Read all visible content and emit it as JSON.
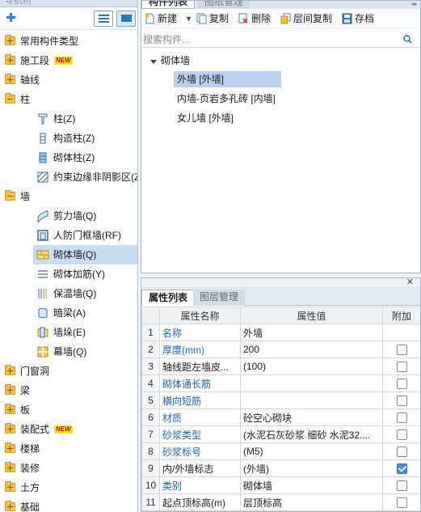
{
  "left_nav": {
    "header_label": "导航树",
    "tree": [
      {
        "label": "常用构件类型",
        "expanded": false
      },
      {
        "label": "施工段",
        "expanded": false,
        "badge": "NEW"
      },
      {
        "label": "轴线",
        "expanded": false
      },
      {
        "label": "柱",
        "expanded": true,
        "children": [
          "柱(Z)",
          "构造柱(Z)",
          "砌体柱(Z)",
          "约束边缘非阴影区(Z)"
        ]
      },
      {
        "label": "墙",
        "expanded": true,
        "children": [
          "剪力墙(Q)",
          "人防门框墙(RF)",
          "砌体墙(Q)",
          "砌体加筋(Y)",
          "保温墙(Q)",
          "暗梁(A)",
          "墙垛(E)",
          "幕墙(Q)"
        ]
      },
      {
        "label": "门窗洞",
        "expanded": false
      },
      {
        "label": "梁",
        "expanded": false
      },
      {
        "label": "板",
        "expanded": false
      },
      {
        "label": "装配式",
        "expanded": false,
        "badge": "NEW"
      },
      {
        "label": "楼梯",
        "expanded": false
      },
      {
        "label": "装修",
        "expanded": false
      },
      {
        "label": "土方",
        "expanded": false
      },
      {
        "label": "基础",
        "expanded": false
      }
    ],
    "selected": "砌体墙(Q)"
  },
  "component_panel": {
    "tabs": [
      "构件列表",
      "图纸管理"
    ],
    "active_tab": "构件列表",
    "toolbar": {
      "new": "新建",
      "copy": "复制",
      "delete": "删除",
      "floor_copy": "层间复制",
      "save": "存档"
    },
    "search_placeholder": "搜索构件...",
    "group": "砌体墙",
    "items": [
      "外墙 [外墙]",
      "内墙-页岩多孔砖 [内墙]",
      "女儿墙 [外墙]"
    ],
    "selected_item": "外墙 [外墙]"
  },
  "property_panel": {
    "tabs": [
      "属性列表",
      "图层管理"
    ],
    "active_tab": "属性列表",
    "columns": [
      "属性名称",
      "属性值",
      "附加"
    ],
    "rows": [
      {
        "idx": "1",
        "name": "名称",
        "value": "外墙",
        "blue": true,
        "checkbox": false,
        "checked": false
      },
      {
        "idx": "2",
        "name": "厚度(mm)",
        "value": "200",
        "blue": true,
        "checkbox": true,
        "checked": false
      },
      {
        "idx": "3",
        "name": "轴线距左墙皮...",
        "value": "(100)",
        "blue": false,
        "checkbox": true,
        "checked": false
      },
      {
        "idx": "4",
        "name": "砌体通长筋",
        "value": "",
        "blue": true,
        "checkbox": true,
        "checked": false
      },
      {
        "idx": "5",
        "name": "横向短筋",
        "value": "",
        "blue": true,
        "checkbox": true,
        "checked": false
      },
      {
        "idx": "6",
        "name": "材质",
        "value": "砼空心砌块",
        "blue": true,
        "checkbox": true,
        "checked": false
      },
      {
        "idx": "7",
        "name": "砂浆类型",
        "value": "(水泥石灰砂浆 细砂  水泥32....",
        "blue": true,
        "checkbox": true,
        "checked": false
      },
      {
        "idx": "8",
        "name": "砂浆标号",
        "value": "(M5)",
        "blue": true,
        "checkbox": true,
        "checked": false
      },
      {
        "idx": "9",
        "name": "内/外墙标志",
        "value": "(外墙)",
        "blue": false,
        "checkbox": true,
        "checked": true
      },
      {
        "idx": "10",
        "name": "类别",
        "value": "砌体墙",
        "blue": true,
        "checkbox": true,
        "checked": false
      },
      {
        "idx": "11",
        "name": "起点顶标高(m)",
        "value": "层顶标高",
        "blue": false,
        "checkbox": true,
        "checked": false
      }
    ]
  }
}
